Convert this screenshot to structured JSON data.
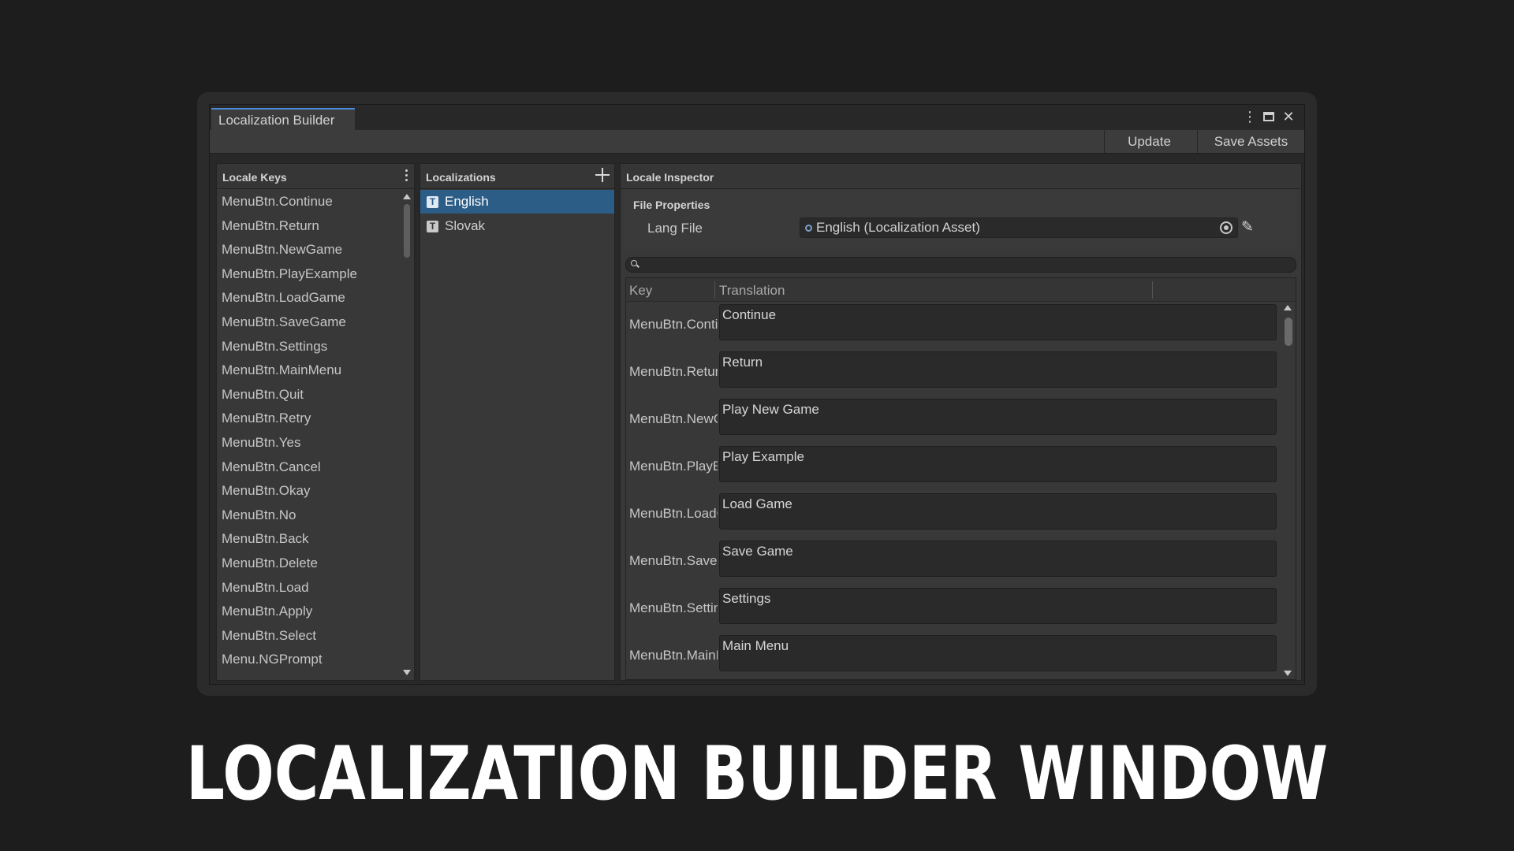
{
  "window": {
    "tab_title": "Localization Builder"
  },
  "toolbar": {
    "update_label": "Update",
    "save_assets_label": "Save Assets"
  },
  "locale_keys": {
    "header": "Locale Keys",
    "items": [
      "MenuBtn.Continue",
      "MenuBtn.Return",
      "MenuBtn.NewGame",
      "MenuBtn.PlayExample",
      "MenuBtn.LoadGame",
      "MenuBtn.SaveGame",
      "MenuBtn.Settings",
      "MenuBtn.MainMenu",
      "MenuBtn.Quit",
      "MenuBtn.Retry",
      "MenuBtn.Yes",
      "MenuBtn.Cancel",
      "MenuBtn.Okay",
      "MenuBtn.No",
      "MenuBtn.Back",
      "MenuBtn.Delete",
      "MenuBtn.Load",
      "MenuBtn.Apply",
      "MenuBtn.Select",
      "Menu.NGPrompt"
    ]
  },
  "localizations": {
    "header": "Localizations",
    "items": [
      {
        "label": "English",
        "icon": "T",
        "selected": true
      },
      {
        "label": "Slovak",
        "icon": "T",
        "selected": false
      }
    ]
  },
  "inspector": {
    "header": "Locale Inspector",
    "file_properties_title": "File Properties",
    "lang_file_label": "Lang File",
    "lang_file_value": "English (Localization Asset)",
    "search_placeholder": "",
    "columns": {
      "key": "Key",
      "translation": "Translation"
    },
    "rows": [
      {
        "key": "MenuBtn.Continue",
        "value": "Continue"
      },
      {
        "key": "MenuBtn.Return",
        "value": "Return"
      },
      {
        "key": "MenuBtn.NewGame",
        "value": "Play New Game"
      },
      {
        "key": "MenuBtn.PlayExample",
        "value": "Play Example"
      },
      {
        "key": "MenuBtn.LoadGame",
        "value": "Load Game"
      },
      {
        "key": "MenuBtn.SaveGame",
        "value": "Save Game"
      },
      {
        "key": "MenuBtn.Settings",
        "value": "Settings"
      },
      {
        "key": "MenuBtn.MainMenu",
        "value": "Main Menu"
      }
    ]
  },
  "caption": "LOCALIZATION BUILDER WINDOW",
  "colors": {
    "background": "#1d1d1d",
    "panel": "#383838",
    "selection": "#2c5d87",
    "tab_accent": "#4a8ad8"
  }
}
